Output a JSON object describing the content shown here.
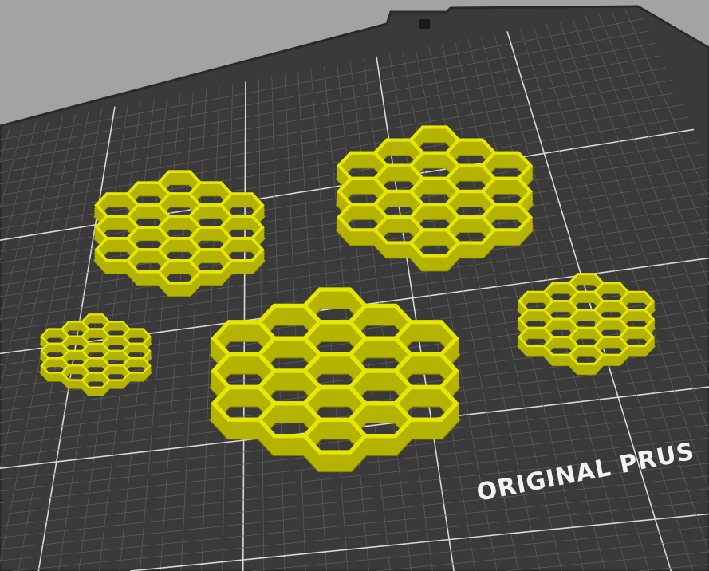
{
  "viewport": {
    "bed_label": "ORIGINAL PRUS",
    "colors": {
      "background": "#a3a3a3",
      "bed": "#3a3a3a",
      "bed_edge": "#2a2a2a",
      "grid_minor": "#5a5a5a",
      "grid_major": "#d8d8d8",
      "part_top": "#e6e600",
      "part_wall": "#b4b400",
      "part_shadow": "#8a8a00"
    },
    "objects": [
      {
        "name": "honeycomb-top-left",
        "rings": 2
      },
      {
        "name": "honeycomb-top-center",
        "rings": 2
      },
      {
        "name": "honeycomb-right",
        "rings": 2
      },
      {
        "name": "honeycomb-small-left",
        "rings": 2
      },
      {
        "name": "honeycomb-large-center",
        "rings": 2
      }
    ]
  }
}
